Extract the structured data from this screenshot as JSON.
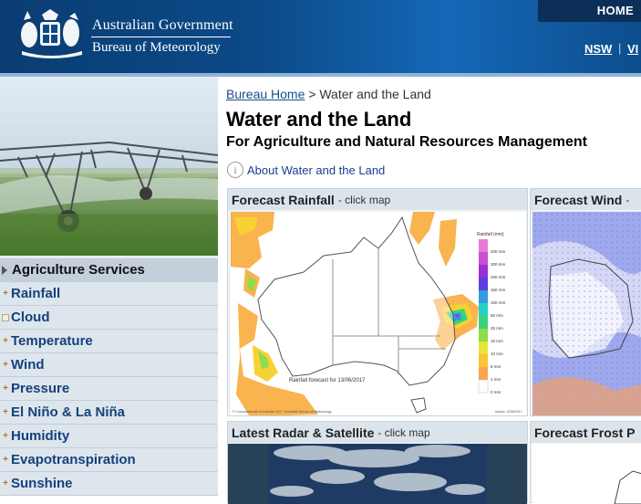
{
  "header": {
    "gov_title": "Australian Government",
    "gov_subtitle": "Bureau of Meteorology",
    "home_link": "HOME",
    "states": [
      "NSW",
      "VI"
    ],
    "colors": {
      "primary": "#0b4a87",
      "accent": "#1568b8"
    }
  },
  "sidebar": {
    "hero_alt": "center-pivot irrigation",
    "items": [
      {
        "label": "Agriculture Services",
        "icon": "arrow-right-icon",
        "active": true
      },
      {
        "label": "Rainfall",
        "icon": "plus-box-icon"
      },
      {
        "label": "Cloud",
        "icon": "empty-box-icon"
      },
      {
        "label": "Temperature",
        "icon": "plus-box-icon"
      },
      {
        "label": "Wind",
        "icon": "plus-box-icon"
      },
      {
        "label": "Pressure",
        "icon": "plus-box-icon"
      },
      {
        "label": "El Niño & La Niña",
        "icon": "plus-box-icon"
      },
      {
        "label": "Humidity",
        "icon": "plus-box-icon"
      },
      {
        "label": "Evapotranspiration",
        "icon": "plus-box-icon"
      },
      {
        "label": "Sunshine",
        "icon": "plus-box-icon"
      }
    ]
  },
  "breadcrumb": {
    "home": "Bureau Home",
    "separator": ">",
    "current": "Water and the Land"
  },
  "page": {
    "title": "Water and the Land",
    "subtitle": "For Agriculture and Natural Resources Management",
    "about_link": "About Water and the Land"
  },
  "panels": {
    "forecast_rainfall": {
      "title": "Forecast Rainfall",
      "hint": "- click map",
      "map_caption": "Rainfall forecast for 13/06/2017",
      "legend_title": "Rainfall (mm)",
      "legend": [
        "400 mm",
        "300 mm",
        "200 mm",
        "150 mm",
        "100 mm",
        "50 mm",
        "25 mm",
        "15 mm",
        "10 mm",
        "5 mm",
        "1 mm",
        "0 mm"
      ],
      "legend_colors": [
        "#e879d9",
        "#c94fd2",
        "#9a31d1",
        "#5b3fe0",
        "#2f9be0",
        "#27d0c4",
        "#39d37a",
        "#8ddc49",
        "#e4e63a",
        "#f8c635",
        "#f9a54e",
        "#ffffff"
      ],
      "footer_left": "© Commonwealth of Australia 2017, Australian Bureau of Meteorology",
      "footer_right": "Issued: 12/06/2017"
    },
    "forecast_wind": {
      "title": "Forecast Wind",
      "hint": "-"
    },
    "latest_radar": {
      "title": "Latest Radar & Satellite",
      "hint": "- click map"
    },
    "forecast_frost": {
      "title": "Forecast Frost P"
    }
  }
}
